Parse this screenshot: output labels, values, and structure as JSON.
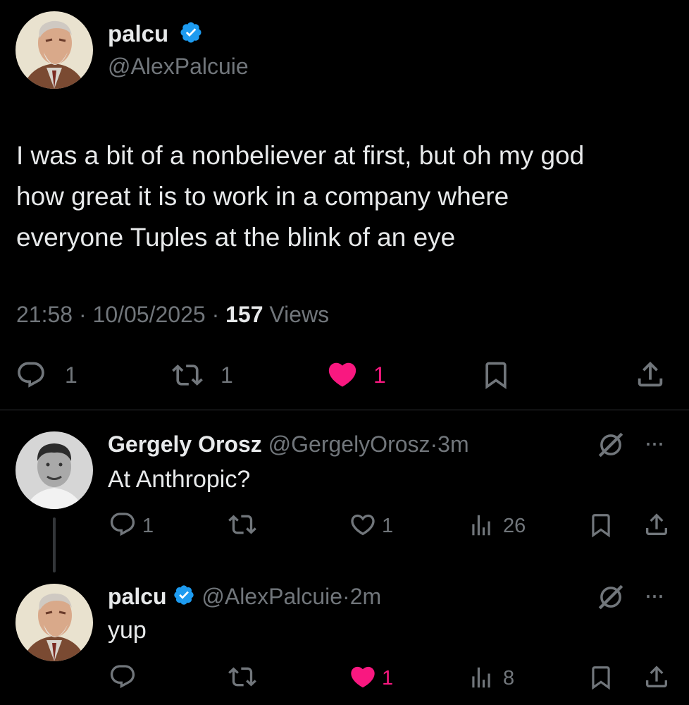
{
  "main_tweet": {
    "display_name": "palcu",
    "handle": "@AlexPalcuie",
    "text_lines": [
      "I was a bit of a nonbeliever at first, but oh my god",
      "how great it is to work in a company where",
      "everyone Tuples at the blink of an eye"
    ],
    "time": "21:58",
    "date": "10/05/2025",
    "views_count": "157",
    "views_label": "Views",
    "replies": "1",
    "reposts": "1",
    "likes": "1"
  },
  "reply_1": {
    "display_name": "Gergely Orosz",
    "handle": "@GergelyOrosz",
    "age": "3m",
    "text": "At Anthropic?",
    "replies": "1",
    "likes": "1",
    "views": "26",
    "more": "···"
  },
  "reply_2": {
    "display_name": "palcu",
    "handle": "@AlexPalcuie",
    "age": "2m",
    "text": "yup",
    "likes": "1",
    "views": "8",
    "more": "···"
  },
  "separator": "·",
  "colors": {
    "background": "#000000",
    "text": "#e7e9ea",
    "muted": "#71767b",
    "like_pink": "#f91880",
    "verified_blue": "#1d9bf0"
  }
}
